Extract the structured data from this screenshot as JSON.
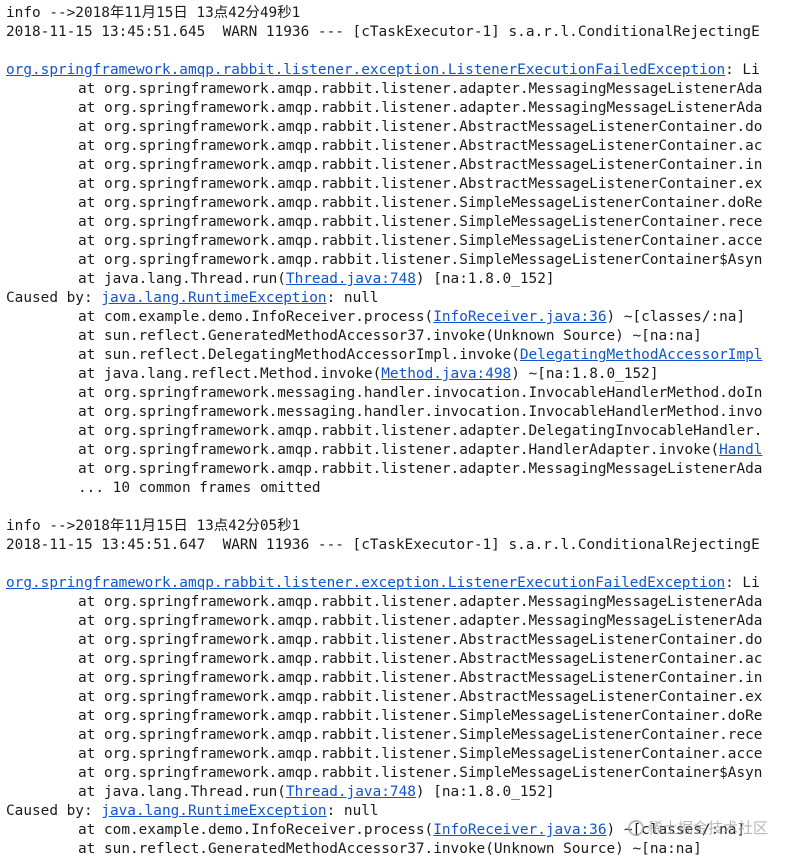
{
  "colors": {
    "text": "#1a1a1a",
    "link": "#1155cc",
    "background": "#ffffff"
  },
  "watermark": {
    "text": "稀土掘金技术社区"
  },
  "lines": [
    {
      "kind": "plain",
      "segments": [
        {
          "t": "info -->2018年11月15日 13点42分49秒1"
        }
      ]
    },
    {
      "kind": "plain",
      "segments": [
        {
          "t": "2018-11-15 13:45:51.645  WARN 11936 --- [cTaskExecutor-1] s.a.r.l.ConditionalRejectingE"
        }
      ]
    },
    {
      "kind": "blank",
      "segments": []
    },
    {
      "kind": "plain",
      "segments": [
        {
          "t": "org.springframework.amqp.rabbit.listener.exception.ListenerExecutionFailedException",
          "link": true
        },
        {
          "t": ": Li"
        }
      ]
    },
    {
      "kind": "frame",
      "segments": [
        {
          "t": "at org.springframework.amqp.rabbit.listener.adapter.MessagingMessageListenerAda"
        }
      ]
    },
    {
      "kind": "frame",
      "segments": [
        {
          "t": "at org.springframework.amqp.rabbit.listener.adapter.MessagingMessageListenerAda"
        }
      ]
    },
    {
      "kind": "frame",
      "segments": [
        {
          "t": "at org.springframework.amqp.rabbit.listener.AbstractMessageListenerContainer.do"
        }
      ]
    },
    {
      "kind": "frame",
      "segments": [
        {
          "t": "at org.springframework.amqp.rabbit.listener.AbstractMessageListenerContainer.ac"
        }
      ]
    },
    {
      "kind": "frame",
      "segments": [
        {
          "t": "at org.springframework.amqp.rabbit.listener.AbstractMessageListenerContainer.in"
        }
      ]
    },
    {
      "kind": "frame",
      "segments": [
        {
          "t": "at org.springframework.amqp.rabbit.listener.AbstractMessageListenerContainer.ex"
        }
      ]
    },
    {
      "kind": "frame",
      "segments": [
        {
          "t": "at org.springframework.amqp.rabbit.listener.SimpleMessageListenerContainer.doRe"
        }
      ]
    },
    {
      "kind": "frame",
      "segments": [
        {
          "t": "at org.springframework.amqp.rabbit.listener.SimpleMessageListenerContainer.rece"
        }
      ]
    },
    {
      "kind": "frame",
      "segments": [
        {
          "t": "at org.springframework.amqp.rabbit.listener.SimpleMessageListenerContainer.acce"
        }
      ]
    },
    {
      "kind": "frame",
      "segments": [
        {
          "t": "at org.springframework.amqp.rabbit.listener.SimpleMessageListenerContainer$Asyn"
        }
      ]
    },
    {
      "kind": "frame",
      "segments": [
        {
          "t": "at java.lang.Thread.run("
        },
        {
          "t": "Thread.java:748",
          "link": true
        },
        {
          "t": ") [na:1.8.0_152]"
        }
      ]
    },
    {
      "kind": "plain",
      "segments": [
        {
          "t": "Caused by: "
        },
        {
          "t": "java.lang.RuntimeException",
          "link": true
        },
        {
          "t": ": null"
        }
      ]
    },
    {
      "kind": "frame",
      "segments": [
        {
          "t": "at com.example.demo.InfoReceiver.process("
        },
        {
          "t": "InfoReceiver.java:36",
          "link": true
        },
        {
          "t": ") ~[classes/:na]"
        }
      ]
    },
    {
      "kind": "frame",
      "segments": [
        {
          "t": "at sun.reflect.GeneratedMethodAccessor37.invoke(Unknown Source) ~[na:na]"
        }
      ]
    },
    {
      "kind": "frame",
      "segments": [
        {
          "t": "at sun.reflect.DelegatingMethodAccessorImpl.invoke("
        },
        {
          "t": "DelegatingMethodAccessorImpl",
          "link": true
        }
      ]
    },
    {
      "kind": "frame",
      "segments": [
        {
          "t": "at java.lang.reflect.Method.invoke("
        },
        {
          "t": "Method.java:498",
          "link": true
        },
        {
          "t": ") ~[na:1.8.0_152]"
        }
      ]
    },
    {
      "kind": "frame",
      "segments": [
        {
          "t": "at org.springframework.messaging.handler.invocation.InvocableHandlerMethod.doIn"
        }
      ]
    },
    {
      "kind": "frame",
      "segments": [
        {
          "t": "at org.springframework.messaging.handler.invocation.InvocableHandlerMethod.invo"
        }
      ]
    },
    {
      "kind": "frame",
      "segments": [
        {
          "t": "at org.springframework.amqp.rabbit.listener.adapter.DelegatingInvocableHandler."
        }
      ]
    },
    {
      "kind": "frame",
      "segments": [
        {
          "t": "at org.springframework.amqp.rabbit.listener.adapter.HandlerAdapter.invoke("
        },
        {
          "t": "Handl",
          "link": true
        }
      ]
    },
    {
      "kind": "frame",
      "segments": [
        {
          "t": "at org.springframework.amqp.rabbit.listener.adapter.MessagingMessageListenerAda"
        }
      ]
    },
    {
      "kind": "frame",
      "segments": [
        {
          "t": "... 10 common frames omitted"
        }
      ]
    },
    {
      "kind": "blank",
      "segments": []
    },
    {
      "kind": "plain",
      "segments": [
        {
          "t": "info -->2018年11月15日 13点42分05秒1"
        }
      ]
    },
    {
      "kind": "plain",
      "segments": [
        {
          "t": "2018-11-15 13:45:51.647  WARN 11936 --- [cTaskExecutor-1] s.a.r.l.ConditionalRejectingE"
        }
      ]
    },
    {
      "kind": "blank",
      "segments": []
    },
    {
      "kind": "plain",
      "segments": [
        {
          "t": "org.springframework.amqp.rabbit.listener.exception.ListenerExecutionFailedException",
          "link": true
        },
        {
          "t": ": Li"
        }
      ]
    },
    {
      "kind": "frame",
      "segments": [
        {
          "t": "at org.springframework.amqp.rabbit.listener.adapter.MessagingMessageListenerAda"
        }
      ]
    },
    {
      "kind": "frame",
      "segments": [
        {
          "t": "at org.springframework.amqp.rabbit.listener.adapter.MessagingMessageListenerAda"
        }
      ]
    },
    {
      "kind": "frame",
      "segments": [
        {
          "t": "at org.springframework.amqp.rabbit.listener.AbstractMessageListenerContainer.do"
        }
      ]
    },
    {
      "kind": "frame",
      "segments": [
        {
          "t": "at org.springframework.amqp.rabbit.listener.AbstractMessageListenerContainer.ac"
        }
      ]
    },
    {
      "kind": "frame",
      "segments": [
        {
          "t": "at org.springframework.amqp.rabbit.listener.AbstractMessageListenerContainer.in"
        }
      ]
    },
    {
      "kind": "frame",
      "segments": [
        {
          "t": "at org.springframework.amqp.rabbit.listener.AbstractMessageListenerContainer.ex"
        }
      ]
    },
    {
      "kind": "frame",
      "segments": [
        {
          "t": "at org.springframework.amqp.rabbit.listener.SimpleMessageListenerContainer.doRe"
        }
      ]
    },
    {
      "kind": "frame",
      "segments": [
        {
          "t": "at org.springframework.amqp.rabbit.listener.SimpleMessageListenerContainer.rece"
        }
      ]
    },
    {
      "kind": "frame",
      "segments": [
        {
          "t": "at org.springframework.amqp.rabbit.listener.SimpleMessageListenerContainer.acce"
        }
      ]
    },
    {
      "kind": "frame",
      "segments": [
        {
          "t": "at org.springframework.amqp.rabbit.listener.SimpleMessageListenerContainer$Asyn"
        }
      ]
    },
    {
      "kind": "frame",
      "segments": [
        {
          "t": "at java.lang.Thread.run("
        },
        {
          "t": "Thread.java:748",
          "link": true
        },
        {
          "t": ") [na:1.8.0_152]"
        }
      ]
    },
    {
      "kind": "plain",
      "segments": [
        {
          "t": "Caused by: "
        },
        {
          "t": "java.lang.RuntimeException",
          "link": true
        },
        {
          "t": ": null"
        }
      ]
    },
    {
      "kind": "frame",
      "segments": [
        {
          "t": "at com.example.demo.InfoReceiver.process("
        },
        {
          "t": "InfoReceiver.java:36",
          "link": true
        },
        {
          "t": ") ~[classes/:na]"
        }
      ]
    },
    {
      "kind": "frame",
      "segments": [
        {
          "t": "at sun.reflect.GeneratedMethodAccessor37.invoke(Unknown Source) ~[na:na]"
        }
      ]
    }
  ]
}
